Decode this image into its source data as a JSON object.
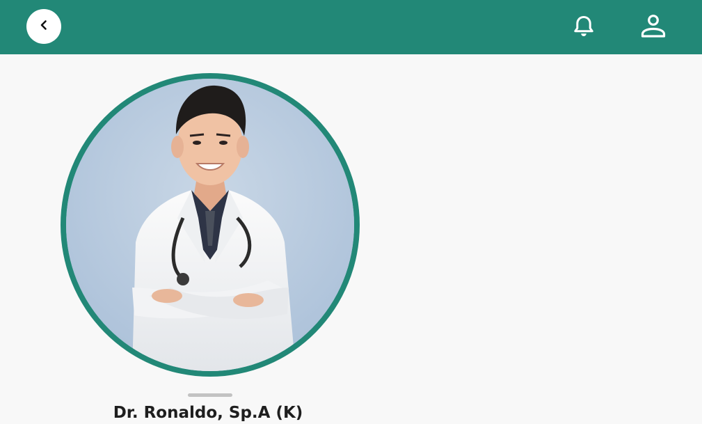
{
  "header": {
    "background_color": "#228877",
    "back_icon": "chevron-left-icon",
    "notification_icon": "bell-icon",
    "profile_icon": "user-icon"
  },
  "profile": {
    "photo": "doctor-portrait",
    "ring_color": "#228877",
    "name": "Dr. Ronaldo, Sp.A (K)"
  }
}
